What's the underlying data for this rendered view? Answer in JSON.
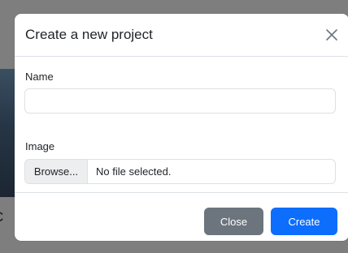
{
  "modal": {
    "title": "Create a new project",
    "fields": {
      "name": {
        "label": "Name",
        "value": "",
        "placeholder": ""
      },
      "image": {
        "label": "Image",
        "browse_label": "Browse...",
        "status": "No file selected."
      }
    },
    "footer": {
      "close_label": "Close",
      "create_label": "Create"
    }
  },
  "background_text": "C",
  "colors": {
    "backdrop": "#7e7e7e",
    "close_button": "#6c757d",
    "create_button": "#0d6efd"
  },
  "icons": {
    "close": "close-icon"
  }
}
